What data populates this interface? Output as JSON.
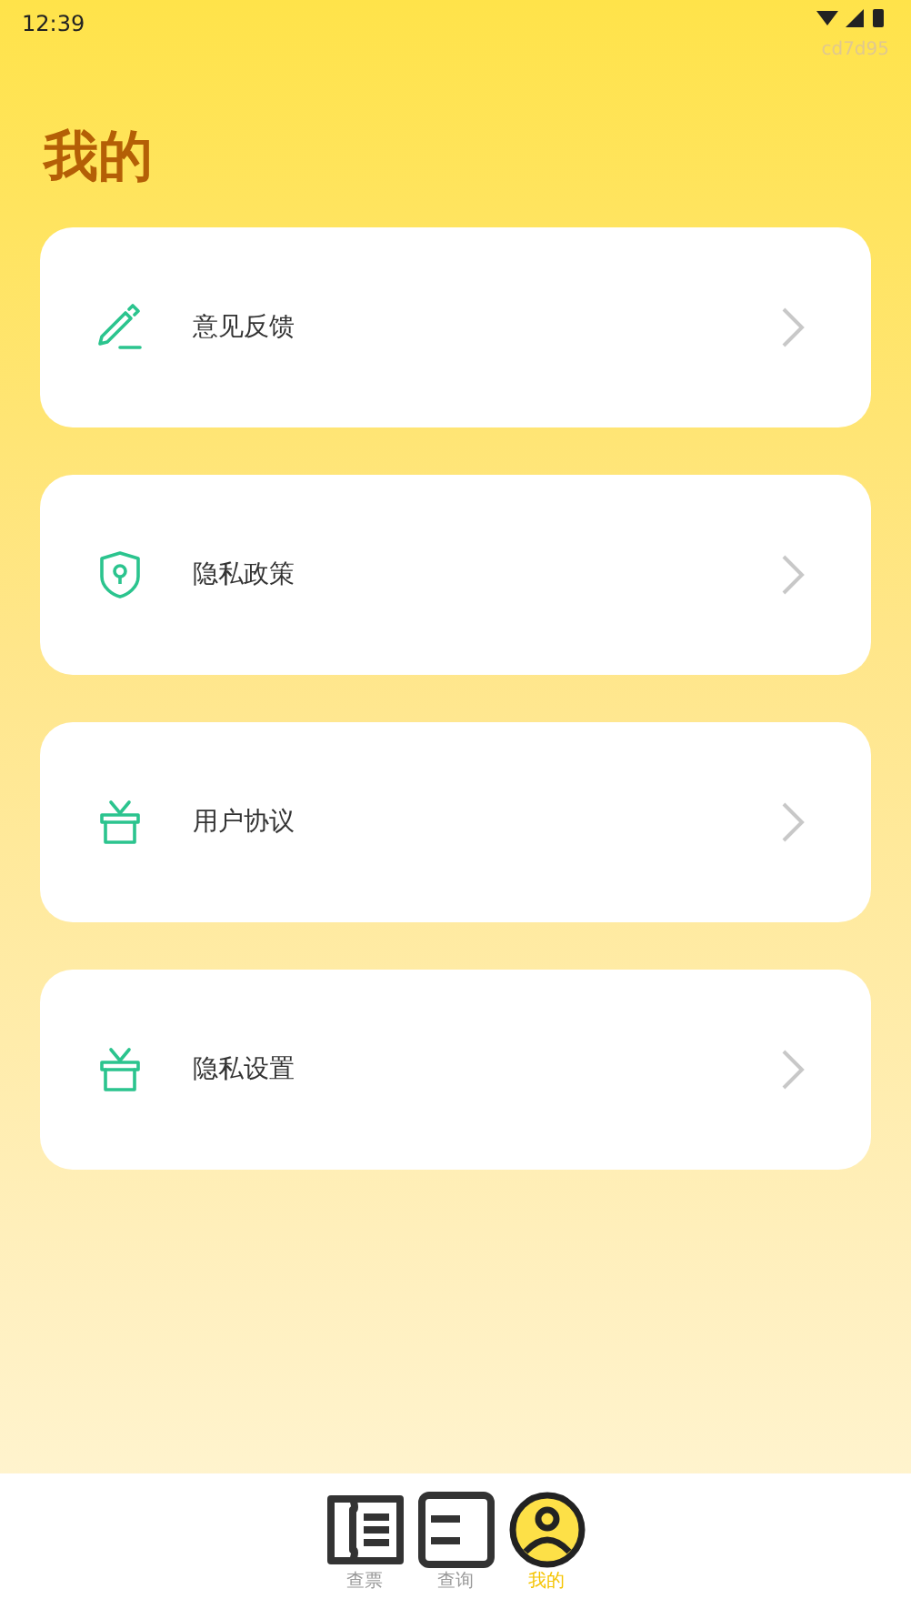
{
  "status_bar": {
    "time": "12:39",
    "build": "cd7d95"
  },
  "title": "我的",
  "items": [
    {
      "label": "意见反馈",
      "kind": "pen"
    },
    {
      "label": "隐私政策",
      "kind": "shield"
    },
    {
      "label": "用户协议",
      "kind": "gift"
    },
    {
      "label": "隐私设置",
      "kind": "gift"
    }
  ],
  "tabs": [
    {
      "label": "查票",
      "kind": "ticket",
      "selected": false
    },
    {
      "label": "查询",
      "kind": "doc",
      "selected": false
    },
    {
      "label": "我的",
      "kind": "user",
      "selected": true
    }
  ]
}
